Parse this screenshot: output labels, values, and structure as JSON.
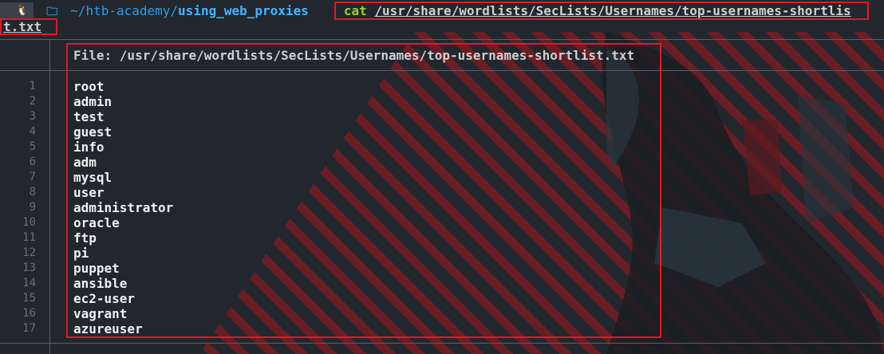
{
  "prompt": {
    "os_icon": "linux-tux-icon",
    "os_glyph": "🐧",
    "folder_icon": "folder-icon",
    "folder_glyph": "▬",
    "path_prefix": "~/htb-academy/",
    "path_current": "using_web_proxies",
    "command": "cat",
    "argument": "/usr/share/wordlists/SecLists/Usernames/top-usernames-shortlis",
    "argument_wrap": "t.txt"
  },
  "bat": {
    "file_label": "File: /usr/share/wordlists/SecLists/Usernames/top-usernames-shortlist.txt",
    "line_numbers": [
      "1",
      "2",
      "3",
      "4",
      "5",
      "6",
      "7",
      "8",
      "9",
      "10",
      "11",
      "12",
      "13",
      "14",
      "15",
      "16",
      "17"
    ],
    "lines": [
      "root",
      "admin",
      "test",
      "guest",
      "info",
      "adm",
      "mysql",
      "user",
      "administrator",
      "oracle",
      "ftp",
      "pi",
      "puppet",
      "ansible",
      "ec2-user",
      "vagrant",
      "azureuser"
    ]
  },
  "colors": {
    "background": "#22262d",
    "highlight_box": "#e01b24",
    "path": "#2d9ee8",
    "command": "#9acd32",
    "stripes": "#8b1d24"
  }
}
